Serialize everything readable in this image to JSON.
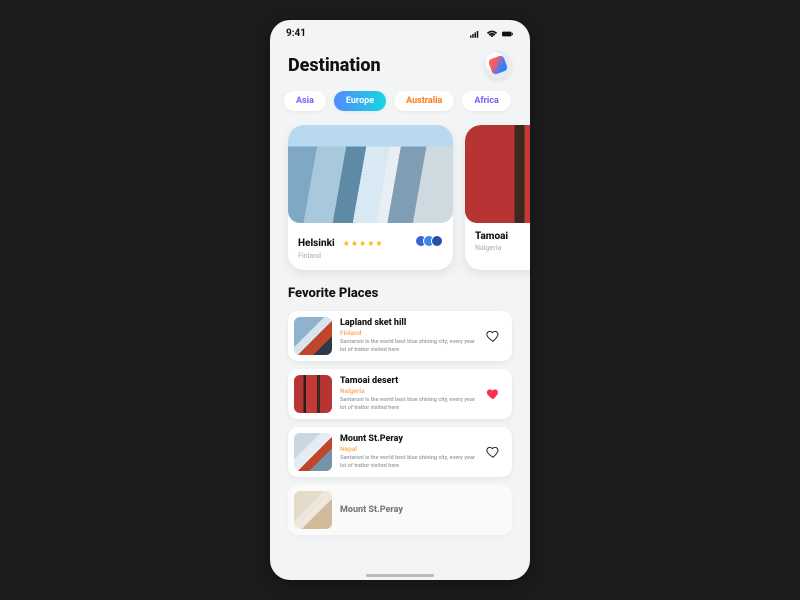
{
  "status": {
    "time": "9:41"
  },
  "header": {
    "title": "Destination"
  },
  "tabs": [
    {
      "label": "Asia",
      "cls": "asia"
    },
    {
      "label": "Europe",
      "cls": "europe"
    },
    {
      "label": "Australia",
      "cls": "australia"
    },
    {
      "label": "Africa",
      "cls": "africa"
    }
  ],
  "cards": [
    {
      "name": "Helsinki",
      "country": "Finland",
      "stars": "★★★★★"
    },
    {
      "name": "Tamoai",
      "country": "Nalgeria",
      "stars": ""
    }
  ],
  "section_favorite": "Fevorite Places",
  "favorites": [
    {
      "name": "Lapland sket hill",
      "country": "Finland",
      "desc": "Santaroni is the world best blue shining city, every year lot of traitor visited here",
      "liked": false
    },
    {
      "name": "Tamoai desert",
      "country": "Nalgeria",
      "desc": "Santaroni is the world best blue shining city, every year lot of traitor visited here",
      "liked": true
    },
    {
      "name": "Mount St.Peray",
      "country": "Nepal",
      "desc": "Santaroni is the world best blue shining city, every year lot of traitor visited here",
      "liked": false
    },
    {
      "name": "Mount St.Peray",
      "country": "",
      "desc": "",
      "liked": false
    }
  ]
}
